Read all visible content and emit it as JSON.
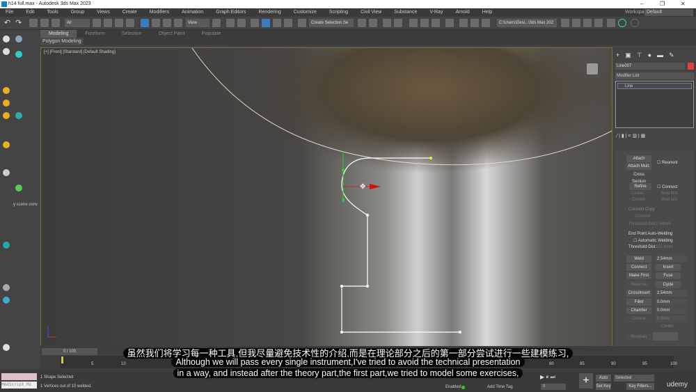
{
  "window": {
    "title": "h14 full.max - Autodesk 3ds Max 2023",
    "minimize": "–",
    "maximize": "❐",
    "close": "✕"
  },
  "menu": [
    "File",
    "Edit",
    "Tools",
    "Group",
    "Views",
    "Create",
    "Modifiers",
    "Animation",
    "Graph Editors",
    "Rendering",
    "Customize",
    "Scripting",
    "Civil View",
    "Substance",
    "V-Ray",
    "Arnold",
    "Help"
  ],
  "workspaces": {
    "label": "Workspaces:",
    "value": "Default"
  },
  "toolbar": {
    "filter": "All",
    "ref_coord": "View",
    "selection_set": "Create Selection Se",
    "path": "C:\\Users\\Desi...\\3ds Max 202"
  },
  "ribbon": {
    "tabs": [
      "Modeling",
      "Freeform",
      "Selection",
      "Object Paint",
      "Populate"
    ],
    "active": "Modeling",
    "sub": "Polygon Modeling"
  },
  "viewport": {
    "label": "[+] [Front] [Standard] [Default Shading]"
  },
  "left": {
    "scene_conv": "y scene conv"
  },
  "command_panel": {
    "object_name": "Line007",
    "object_color": "#e04040",
    "modifier_list": "Modifier List",
    "stack_item": "Line",
    "attach": "Attach",
    "attach_mult": "Attach Mult.",
    "reorient": "Reorient",
    "cross_section": "Cross Section",
    "refine": "Refine",
    "connect": "Connect",
    "linear": "Linear",
    "bind_first": "Bind first",
    "closed": "Closed",
    "bind_last": "Bind last",
    "connect_copy": "Connect Copy",
    "connect_cb": "Connect",
    "threshold": "Threshold Dist",
    "threshold_val": "2.54mm",
    "end_point": "End Point Auto-Welding",
    "auto_weld": "Automatic Welding",
    "threshold2_val": "152.4mm",
    "weld": "Weld",
    "weld_val": "2.54mm",
    "connect_btn": "Connect",
    "insert": "Insert",
    "make_first": "Make First",
    "fuse": "Fuse",
    "reverse": "Reverse",
    "cycle": "Cycle",
    "crossinsert": "CrossInsert",
    "crossinsert_val": "2.54mm",
    "fillet": "Fillet",
    "fillet_val": "0.0mm",
    "chamfer": "Chamfer",
    "chamfer_val": "0.0mm",
    "outline": "Outline",
    "outline_val": "0.0mm",
    "center": "Center",
    "boolean": "Boolean"
  },
  "timeline": {
    "frame": "0 / 100",
    "ticks": [
      "0",
      "5",
      "10",
      "80",
      "85",
      "90",
      "95",
      "100"
    ]
  },
  "status": {
    "selected": "1 Shape Selected",
    "prompt": "1 Vertices out of 10 welded.",
    "maxscript": "MAXScript Mi",
    "enabled": "Enabled:",
    "add_time_tag": "Add Time Tag",
    "frame_field": "0",
    "auto_key": "Auto Key",
    "set_key": "Set Key",
    "key_mode": "Selected",
    "key_filters": "Key Filters...",
    "watermark": "udemy"
  },
  "subtitles": {
    "zh": "虽然我们将学习每一种工具,但我尽量避免技术性的介绍,而是在理论部分之后的第一部分尝试进行一些建模练习,",
    "en1": "Although we will pass every single instrument,I've tried to avoid the technical presentation",
    "en2": "in a way, and instead after the theory part,the first part,we tried to model some exercises,"
  }
}
